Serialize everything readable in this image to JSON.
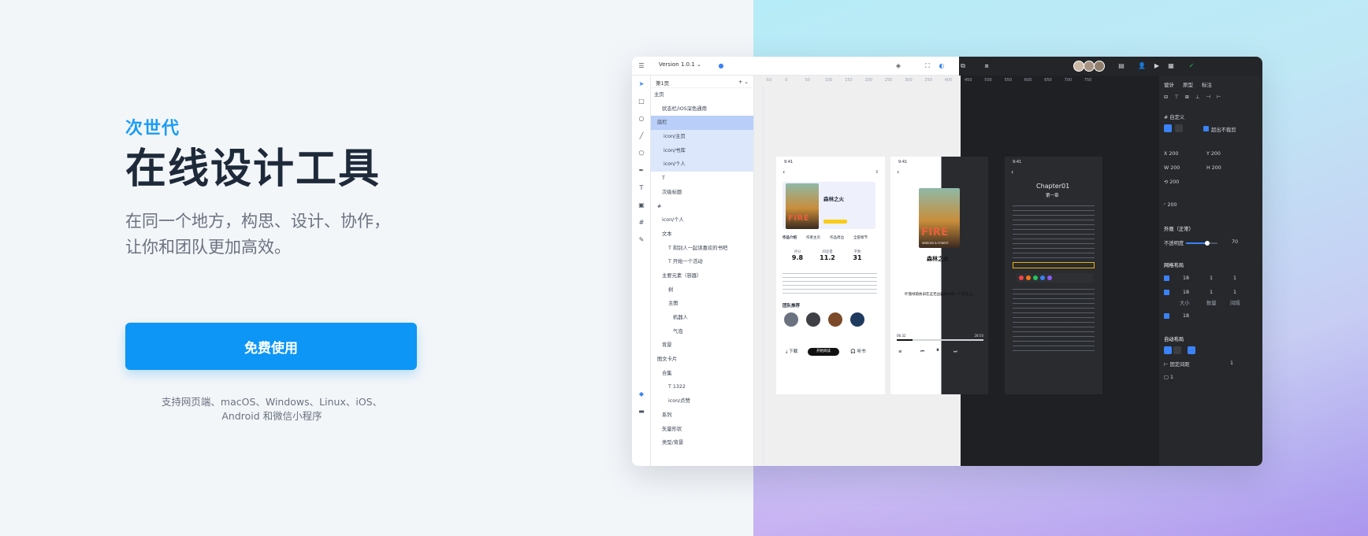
{
  "hero": {
    "eyebrow": "次世代",
    "title": "在线设计工具",
    "subtitle_line1": "在同一个地方，构思、设计、协作，",
    "subtitle_line2": "让你和团队更加高效。",
    "cta": "免费使用",
    "platforms_line1": "支持网页端、macOS、Windows、Linux、iOS、",
    "platforms_line2": "Android 和微信小程序"
  },
  "app": {
    "version": "Version 1.0.1",
    "page_label": "第1页",
    "layers": [
      {
        "label": "主页",
        "state": "normal"
      },
      {
        "label": "状态栏/iOS深色通用",
        "state": "normal"
      },
      {
        "label": "底栏",
        "state": "sel"
      },
      {
        "label": "icon/主页",
        "state": "hl"
      },
      {
        "label": "icon/书库",
        "state": "hl"
      },
      {
        "label": "icon/个人",
        "state": "hl"
      },
      {
        "label": "T",
        "state": "normal"
      },
      {
        "label": "次级标题",
        "state": "normal"
      },
      {
        "label": "#",
        "state": "normal"
      },
      {
        "label": "icon/个人",
        "state": "normal"
      },
      {
        "label": "文本",
        "state": "normal"
      },
      {
        "label": "T 和别人一起读喜欢的书吧",
        "state": "normal"
      },
      {
        "label": "T 开始一个活动",
        "state": "normal"
      },
      {
        "label": "主要元素（容器）",
        "state": "normal"
      },
      {
        "label": "树",
        "state": "normal"
      },
      {
        "label": "主图",
        "state": "normal"
      },
      {
        "label": "机器人",
        "state": "normal"
      },
      {
        "label": "气泡",
        "state": "normal"
      },
      {
        "label": "背景",
        "state": "normal"
      },
      {
        "label": "图文卡片",
        "state": "normal"
      },
      {
        "label": "合集",
        "state": "normal"
      },
      {
        "label": "T 1322",
        "state": "normal"
      },
      {
        "label": "icon/点赞",
        "state": "normal"
      },
      {
        "label": "系列",
        "state": "normal"
      },
      {
        "label": "矢量形状",
        "state": "normal"
      },
      {
        "label": "类型/背景",
        "state": "normal"
      }
    ],
    "ruler": [
      "-50",
      "0",
      "50",
      "100",
      "150",
      "200",
      "250",
      "300",
      "350",
      "400",
      "450",
      "500",
      "550",
      "600",
      "650",
      "700",
      "750"
    ],
    "phone1": {
      "time": "9:41",
      "book_fire": "FIRE",
      "book_title": "森林之火",
      "tabs": [
        "作品介绍",
        "作者主页",
        "作品周边",
        "全部章节"
      ],
      "stats": [
        {
          "value": "9.8",
          "label": "评分"
        },
        {
          "value": "11.2",
          "label": "阅读量"
        },
        {
          "value": "31",
          "label": "字数"
        }
      ],
      "team_label": "团队推荐",
      "btn_download": "下载",
      "btn_read": "开始阅读",
      "btn_listen": "听书"
    },
    "phone2": {
      "time": "9:41",
      "book_fire": "FIRE",
      "book_sub": "WRECKS & FOREST",
      "title": "森林之火",
      "lyric": "叶落绿荫依旧在这无边森林中的一个荒岛上。",
      "time_start": "06:32",
      "time_end": "28:50"
    },
    "phone3": {
      "time": "9:41",
      "chapter": "Chapter01",
      "chapter_cn": "第一章"
    },
    "props": {
      "tabs": [
        "设计",
        "原型",
        "标注"
      ],
      "frame_label": "自定义",
      "clip_label": "超出不裁剪",
      "x": "200",
      "y": "200",
      "w": "200",
      "h": "200",
      "rotation": "200",
      "radius": "200",
      "appearance": "外观（正常）",
      "opacity_label": "不透明度",
      "opacity_value": "70",
      "grid_title": "网格布局",
      "grid_rows": [
        {
          "a": "18",
          "b": "1",
          "c": "1"
        },
        {
          "a": "18",
          "b": "1",
          "c": "1"
        },
        {
          "a": "18"
        }
      ],
      "grid_labels": [
        "大小",
        "数量",
        "间隔"
      ],
      "auto_title": "自动布局",
      "auto_gap_label": "固定间距",
      "auto_gap_value": "1",
      "auto_pad": "1"
    }
  }
}
